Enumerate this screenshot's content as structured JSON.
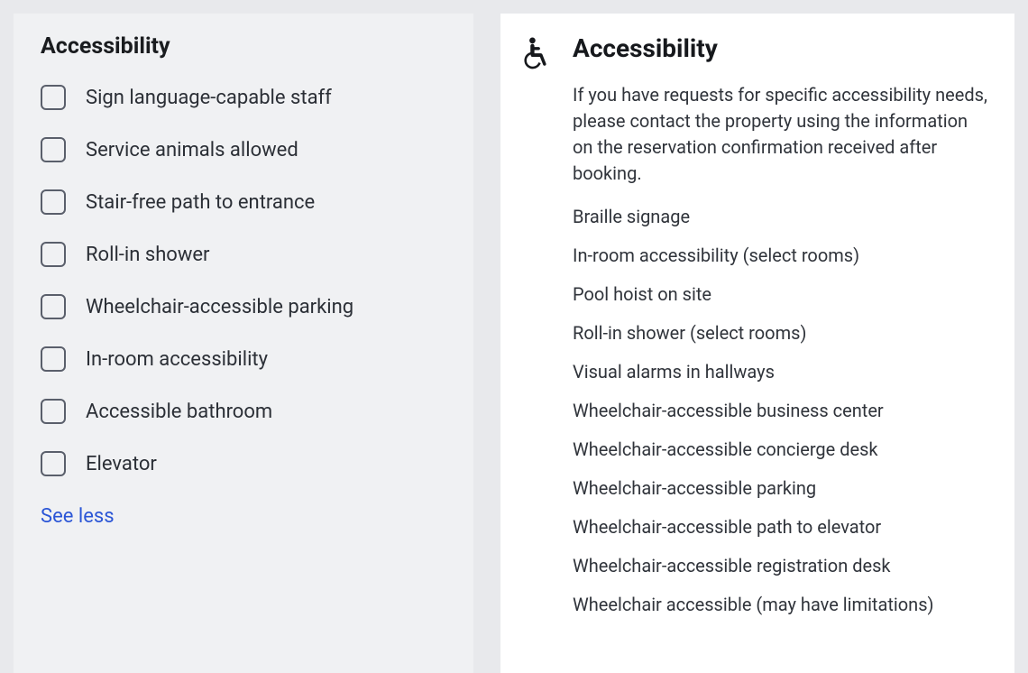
{
  "left": {
    "title": "Accessibility",
    "filters": [
      {
        "label": "Sign language-capable staff"
      },
      {
        "label": "Service animals allowed"
      },
      {
        "label": "Stair-free path to entrance"
      },
      {
        "label": "Roll-in shower"
      },
      {
        "label": "Wheelchair-accessible parking"
      },
      {
        "label": "In-room accessibility"
      },
      {
        "label": "Accessible bathroom"
      },
      {
        "label": "Elevator"
      }
    ],
    "see_less": "See less"
  },
  "right": {
    "title": "Accessibility",
    "description": "If you have requests for specific accessibility needs, please contact the property using the information on the reservation confirmation received after booking.",
    "features": [
      "Braille signage",
      "In-room accessibility (select rooms)",
      "Pool hoist on site",
      "Roll-in shower (select rooms)",
      "Visual alarms in hallways",
      "Wheelchair-accessible business center",
      "Wheelchair-accessible concierge desk",
      "Wheelchair-accessible parking",
      "Wheelchair-accessible path to elevator",
      "Wheelchair-accessible registration desk",
      "Wheelchair accessible (may have limitations)"
    ]
  }
}
